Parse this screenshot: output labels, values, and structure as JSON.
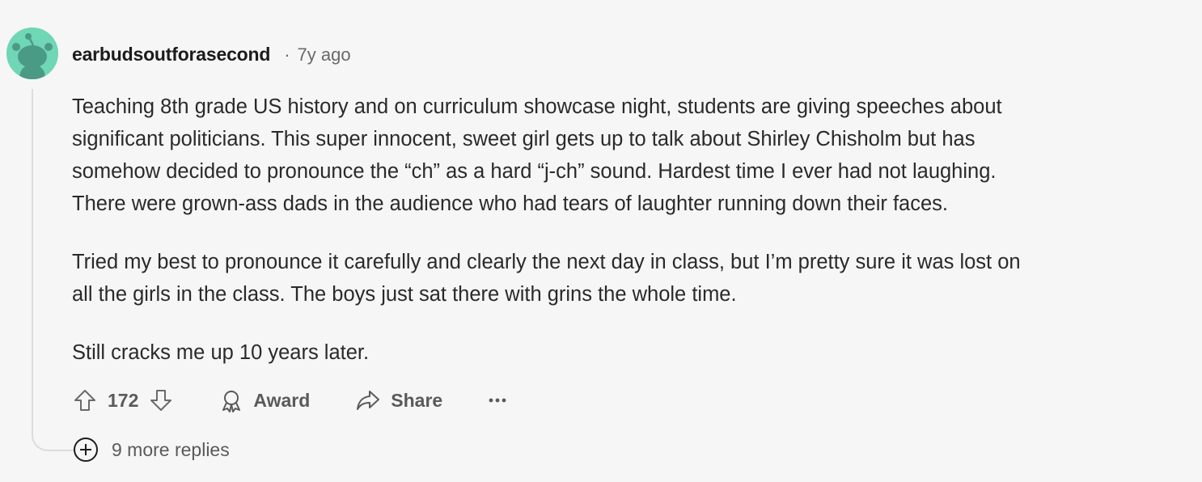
{
  "comment": {
    "author": "earbudsoutforasecond",
    "separator": "·",
    "time_ago": "7y ago",
    "paragraphs": [
      "Teaching 8th grade US history and on curriculum showcase night, students are giving speeches about\nsignificant politicians. This super innocent, sweet girl gets up to talk about Shirley Chisholm but has\nsomehow decided to pronounce the “ch” as a hard “j-ch” sound. Hardest time I ever had not laughing.\nThere were grown-ass dads in the audience who had tears of laughter running down their faces.",
      "Tried my best to pronounce it carefully and clearly the next day in class, but I’m pretty sure it was lost on\nall the girls in the class. The boys just sat there with grins the whole time.",
      "Still cracks me up 10 years later."
    ]
  },
  "actions": {
    "score": "172",
    "award_label": "Award",
    "share_label": "Share",
    "more_label": "···"
  },
  "replies": {
    "more_label": "9 more replies"
  },
  "icons": {
    "avatar": "snoo-avatar-icon",
    "upvote": "arrow-up-icon",
    "downvote": "arrow-down-icon",
    "award": "award-ribbon-icon",
    "share": "share-arrow-icon",
    "more": "ellipsis-icon",
    "expand": "plus-circle-icon"
  },
  "colors": {
    "background": "#f6f6f6",
    "avatar_bg": "#6fd6b6",
    "avatar_figure": "#4b9a86",
    "text_primary": "#1c1c1c",
    "text_secondary": "#5a5a5a",
    "thread_line": "#dcdcdc"
  }
}
